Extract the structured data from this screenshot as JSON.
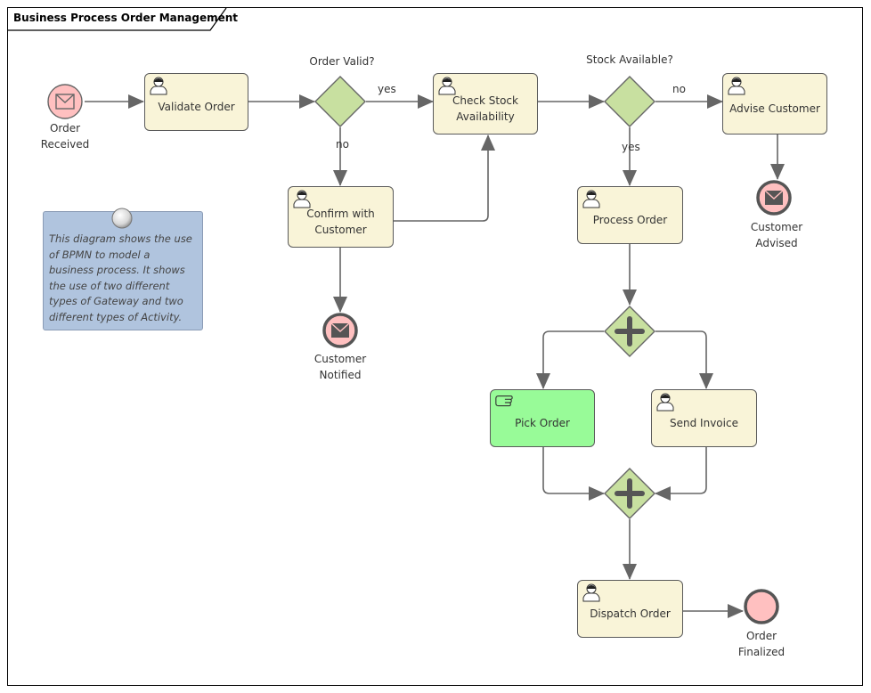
{
  "diagram": {
    "title": "Business Process Order Management",
    "colors": {
      "task_fill": "#f9f4d8",
      "manual_task_fill": "#98fb98",
      "gateway_fill": "#c8e0a0",
      "event_fill": "#ffc0c0",
      "note_fill": "#b0c4de",
      "edge_color": "#666666"
    },
    "note": {
      "text": "This diagram shows the use of BPMN to model a business process. It shows the use of two different types of Gateway and two different types of Activity."
    },
    "events": {
      "order_received": {
        "label": "Order\nReceived",
        "type": "start-message",
        "icon": "envelope-icon"
      },
      "customer_notified": {
        "label": "Customer\nNotified",
        "type": "end-message",
        "icon": "envelope-filled-icon"
      },
      "customer_advised": {
        "label": "Customer\nAdvised",
        "type": "end-message",
        "icon": "envelope-filled-icon"
      },
      "order_finalized": {
        "label": "Order\nFinalized",
        "type": "end-none"
      }
    },
    "tasks": {
      "validate_order": {
        "label": "Validate Order",
        "type": "user",
        "icon": "user-icon"
      },
      "check_stock": {
        "label": "Check Stock\nAvailability",
        "type": "user",
        "icon": "user-icon"
      },
      "advise_customer": {
        "label": "Advise Customer",
        "type": "user",
        "icon": "user-icon"
      },
      "confirm_customer": {
        "label": "Confirm with\nCustomer",
        "type": "user",
        "icon": "user-icon"
      },
      "process_order": {
        "label": "Process Order",
        "type": "user",
        "icon": "user-icon"
      },
      "pick_order": {
        "label": "Pick Order",
        "type": "manual",
        "icon": "hand-icon"
      },
      "send_invoice": {
        "label": "Send Invoice",
        "type": "user",
        "icon": "user-icon"
      },
      "dispatch_order": {
        "label": "Dispatch Order",
        "type": "user",
        "icon": "user-icon"
      }
    },
    "gateways": {
      "order_valid": {
        "label": "Order Valid?",
        "type": "exclusive"
      },
      "stock_available": {
        "label": "Stock Available?",
        "type": "exclusive"
      },
      "fork": {
        "label": "",
        "type": "parallel"
      },
      "join": {
        "label": "",
        "type": "parallel"
      }
    },
    "flow_labels": {
      "order_valid_yes": "yes",
      "order_valid_no": "no",
      "stock_no": "no",
      "stock_yes": "yes"
    }
  }
}
